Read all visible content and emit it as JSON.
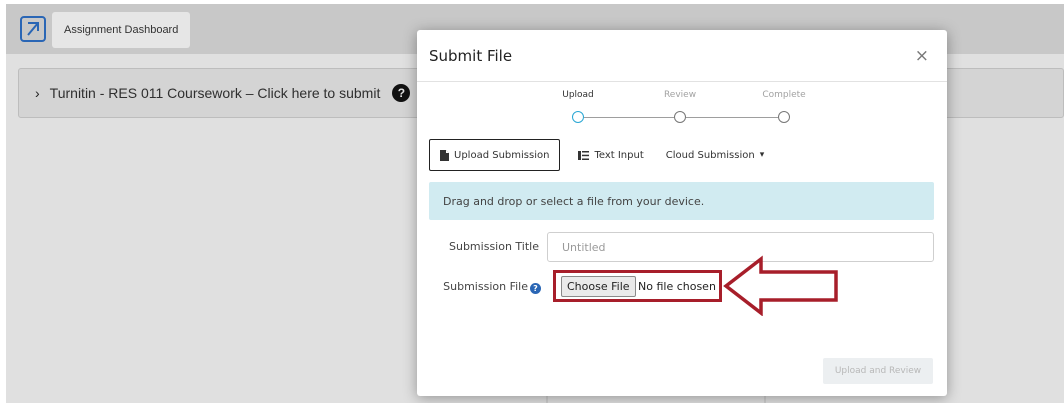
{
  "background": {
    "tab_label": "Assignment Dashboard",
    "assignment_label": "Turnitin - RES 011 Coursework – Click here to submit",
    "help_glyph": "?",
    "chevron": "›"
  },
  "modal": {
    "title": "Submit File",
    "close_glyph": "×",
    "steps": [
      {
        "label": "Upload",
        "active": true
      },
      {
        "label": "Review",
        "active": false
      },
      {
        "label": "Complete",
        "active": false
      }
    ],
    "tabs": {
      "upload": "Upload Submission",
      "text": "Text Input",
      "cloud": "Cloud Submission",
      "cloud_caret": "▾"
    },
    "dropzone_text": "Drag and drop or select a file from your device.",
    "submission_title_label": "Submission Title",
    "submission_title_placeholder": "Untitled",
    "submission_file_label": "Submission File",
    "file_help_glyph": "?",
    "choose_file_label": "Choose File",
    "no_file_text": "No file chosen",
    "upload_review_button": "Upload and Review"
  },
  "colors": {
    "accent": "#2aa7d4",
    "highlight": "#a71e2a",
    "dropzone": "#d1ebf1"
  }
}
